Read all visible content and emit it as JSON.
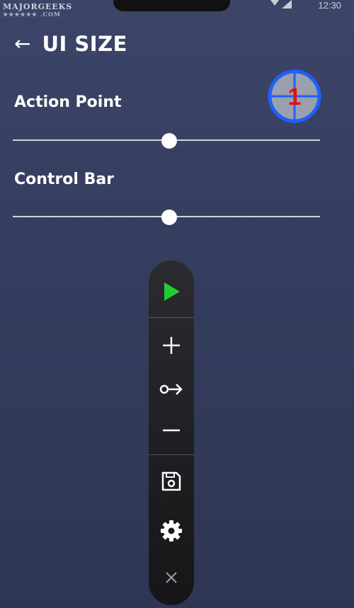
{
  "watermark": {
    "text": "MAJORGEEKS",
    "stars": "★★★★★★ .COM"
  },
  "status_bar": {
    "time": "12:30"
  },
  "header": {
    "back_icon": "arrow-left-icon",
    "title": "UI SIZE"
  },
  "action_point": {
    "label": "Action Point",
    "slider_value_percent": 51,
    "target_preview": {
      "number": "1",
      "ring_color": "#1e60ff",
      "number_color": "#e01010",
      "fill_color": "#9aa0ad"
    }
  },
  "control_bar": {
    "label": "Control Bar",
    "slider_value_percent": 51
  },
  "toolbar": {
    "items": [
      {
        "name": "play",
        "icon": "play-icon",
        "color": "#22cc33"
      },
      {
        "name": "add",
        "icon": "plus-icon"
      },
      {
        "name": "swipe",
        "icon": "swipe-icon"
      },
      {
        "name": "remove",
        "icon": "minus-icon"
      },
      {
        "name": "save",
        "icon": "save-icon"
      },
      {
        "name": "settings",
        "icon": "gear-icon"
      },
      {
        "name": "close",
        "icon": "close-icon"
      }
    ]
  },
  "colors": {
    "background": "#363e60",
    "toolbar": "#1d1d20",
    "accent_green": "#22cc33"
  }
}
